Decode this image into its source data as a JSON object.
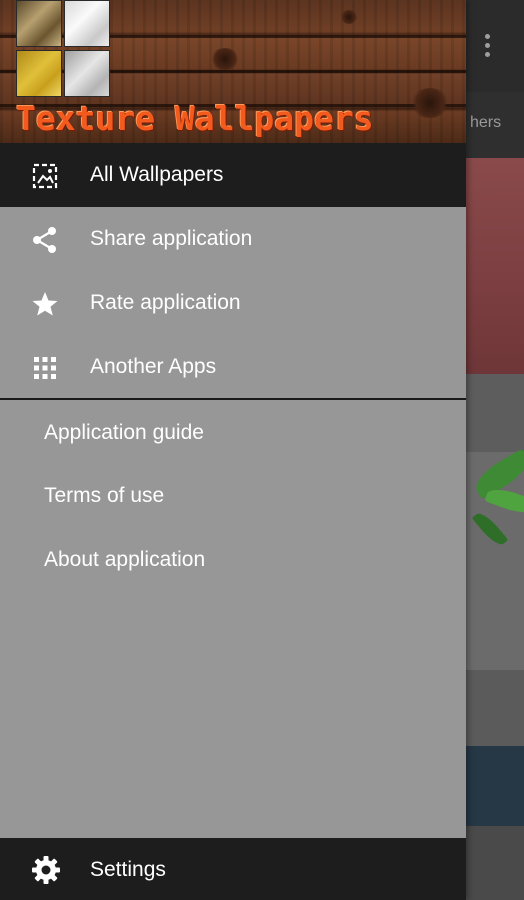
{
  "header": {
    "title": "Texture Wallpapers",
    "tiles": [
      "bronze-tile",
      "silver-tile",
      "gold-tile",
      "steel-tile"
    ]
  },
  "nav": {
    "items": [
      {
        "label": "All Wallpapers",
        "icon": "image-icon",
        "active": true
      },
      {
        "label": "Share application",
        "icon": "share-icon",
        "active": false
      },
      {
        "label": "Rate application",
        "icon": "star-icon",
        "active": false
      },
      {
        "label": "Another Apps",
        "icon": "apps-grid-icon",
        "active": false
      }
    ]
  },
  "secondary": {
    "items": [
      {
        "label": "Application guide"
      },
      {
        "label": "Terms of use"
      },
      {
        "label": "About application"
      }
    ]
  },
  "footer": {
    "settings_label": "Settings",
    "icon": "gear-icon"
  },
  "background": {
    "tab_fragment": "hers"
  },
  "colors": {
    "drawer_bg": "#979797",
    "active_bg": "#1d1d1d",
    "title_color": "#f25a1e"
  }
}
